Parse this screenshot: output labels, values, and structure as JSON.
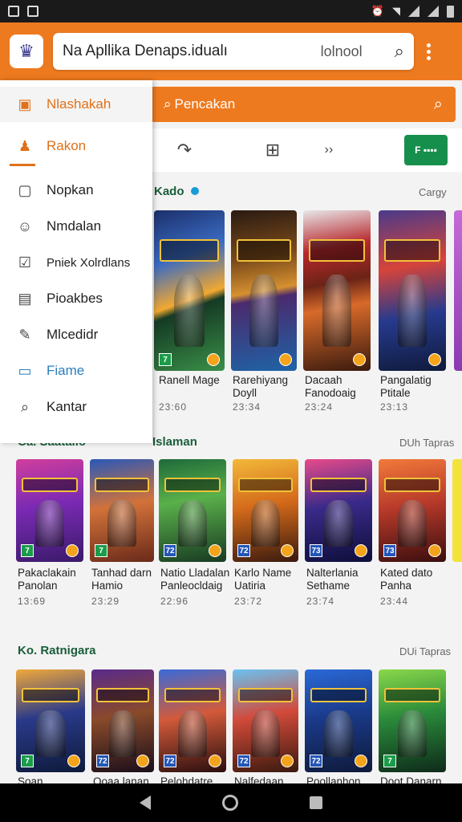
{
  "app": {
    "search_text": "Na Apllika Denaps.idualı",
    "search_hint": "lolnool"
  },
  "subsearch": {
    "placeholder": "Pencakan"
  },
  "toolbar": {
    "green_button": "F ▪▪▪▪"
  },
  "drawer": {
    "items": [
      {
        "label": "Nlashakah",
        "icon": "tag-icon"
      },
      {
        "label": "Rakon",
        "icon": "user-icon"
      },
      {
        "label": "Nopkan",
        "icon": "square-icon"
      },
      {
        "label": "Nmdalan",
        "icon": "user-outline-icon"
      },
      {
        "label": "Pniek Xolrdlans",
        "icon": "checkbox-icon"
      },
      {
        "label": "Pioakbes",
        "icon": "calendar-icon"
      },
      {
        "label": "Mlcedidr",
        "icon": "edit-icon"
      },
      {
        "label": "Fiame",
        "icon": "bag-icon"
      },
      {
        "label": "Kantar",
        "icon": "search-icon"
      }
    ]
  },
  "sections": [
    {
      "title": "Kado",
      "more": "Cargy",
      "games": [
        {
          "title": "Ranell Mage",
          "meta": "23:60",
          "banner": "SONADAN"
        },
        {
          "title": "Rarehiyang Doyll",
          "meta": "23:34",
          "banner": "CADINEUAS"
        },
        {
          "title": "Dacaah Fanodoaig",
          "meta": "23:24",
          "banner": "DINAL"
        },
        {
          "title": "Pangalatig Ptitale",
          "meta": "23:13",
          "banner": "PADAS"
        }
      ]
    },
    {
      "title": "Ca.  Saatalio",
      "title_right": "Islaman",
      "more": "DUh Tapras",
      "games": [
        {
          "title": "Pakaclakain Panolan",
          "meta": "13:69",
          "banner": "BIRSDAN"
        },
        {
          "title": "Tanhad darn Hamio",
          "meta": "23:29",
          "banner": "GOLDLLE"
        },
        {
          "title": "Natio Lladalan Panleocldaig",
          "meta": "22:96",
          "banner": "DADDIN"
        },
        {
          "title": "Karlo Name Uatiria",
          "meta": "23:72",
          "banner": "BIRLEN"
        },
        {
          "title": "Nalterlania Sethame",
          "meta": "23:74",
          "banner": "SAFIDA"
        },
        {
          "title": "Kated dato Panha",
          "meta": "23:44",
          "banner": "DIALDA"
        }
      ]
    },
    {
      "title": "Ko.  Ratnigara",
      "more": "DUi Tapras",
      "games": [
        {
          "title": "Soan",
          "banner": "SOMINN"
        },
        {
          "title": "Ooaa lanan",
          "banner": "BHAH"
        },
        {
          "title": "Pelohdatre",
          "banner": "DAWINS"
        },
        {
          "title": "Nalfedaan",
          "banner": "VAUDN"
        },
        {
          "title": "Poollanhon",
          "banner": "PAHNUS"
        },
        {
          "title": "Doot Danarn",
          "banner": ""
        }
      ]
    }
  ],
  "colors": {
    "accent": "#ee7a1f",
    "green": "#178f4c"
  }
}
